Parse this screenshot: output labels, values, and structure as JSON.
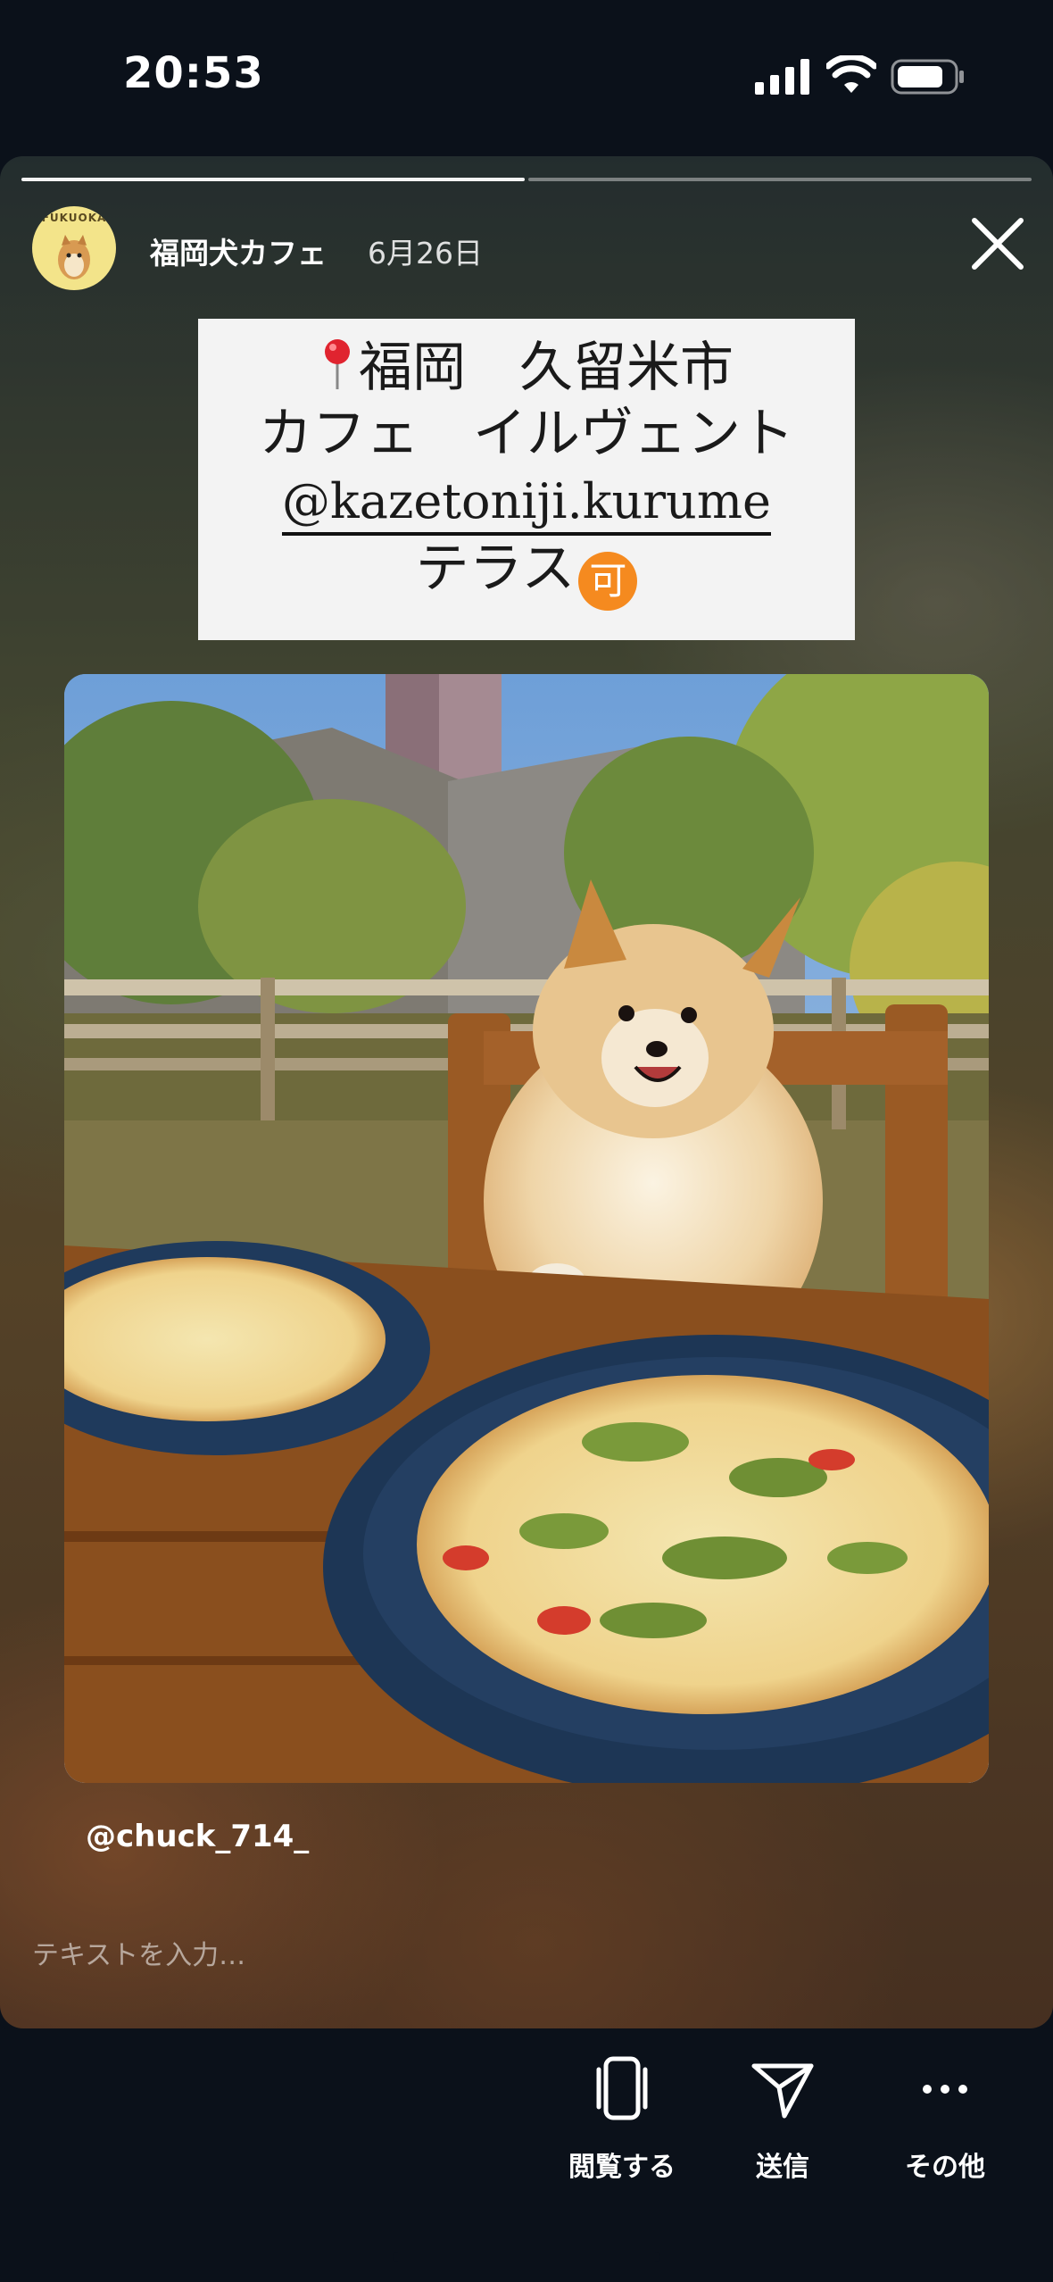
{
  "status_bar": {
    "time": "20:53"
  },
  "story": {
    "account_name": "福岡犬カフェ",
    "avatar_text": "FUKUOKA",
    "date": "6月26日",
    "progress": {
      "segments": 2,
      "current": 1
    },
    "caption": {
      "line1": "福岡　久留米市",
      "line2": "カフェ　イルヴェント",
      "handle": "@kazetoniji.kurume",
      "line4": "テラス",
      "badge": "可"
    },
    "photo_credit": "@chuck_714_",
    "reply_placeholder": "テキストを入力…"
  },
  "actions": [
    {
      "label": "閲覧する",
      "icon": "phone-outline-icon"
    },
    {
      "label": "送信",
      "icon": "paper-plane-icon"
    },
    {
      "label": "その他",
      "icon": "more-dots-icon"
    }
  ],
  "colors": {
    "accent_badge": "#f58a1f",
    "background": "#0b111a"
  }
}
